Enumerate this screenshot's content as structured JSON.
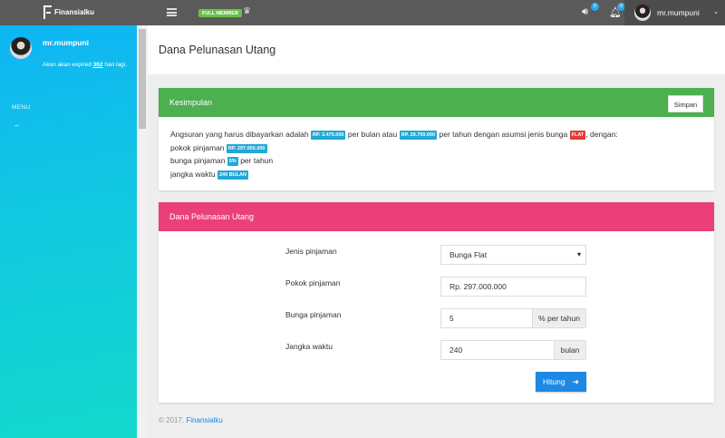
{
  "topbar": {
    "brand": "Finansialku",
    "member_badge": "FULL MEMBER",
    "sound_count": "0",
    "bell_count": "0",
    "username": "mr.mumpuni"
  },
  "sidebar": {
    "username": "mr.mumpuni",
    "expire_prefix": "Akun akan expired",
    "expire_days": "362",
    "expire_suffix": "hari lagi.",
    "menu_label": "MENU",
    "menu_dash": "–"
  },
  "page": {
    "title": "Dana Pelunasan Utang"
  },
  "summary_card": {
    "title": "Kesimpulan",
    "save_label": "Simpan",
    "text1": "Angsuran yang harus dibayarkan adalah",
    "monthly": "RP. 3.475.000",
    "text2": "per bulan atau",
    "yearly": "RP. 29.700.000",
    "text3": "per tahun dengan asumsi jenis bunga",
    "interest_type": "FLAT",
    "text4": ", dengan:",
    "principal_label": "pokok pinjaman",
    "principal": "RP. 297.000.000",
    "rate_label": "bunga pinjaman",
    "rate": "5%",
    "rate_suffix": "per tahun",
    "term_label": "jangka waktu",
    "term": "240 BULAN"
  },
  "form_card": {
    "title": "Dana Pelunasan Utang",
    "loan_type_label": "Jenis pinjaman",
    "loan_type_value": "Bunga Flat",
    "principal_label": "Pokok pinjaman",
    "principal_value": "Rp. 297.000.000",
    "rate_label": "Bunga pinjaman",
    "rate_value": "5",
    "rate_addon": "% per tahun",
    "term_label": "Jangka waktu",
    "term_value": "240",
    "term_addon": "bulan",
    "submit_label": "Hitung"
  },
  "footer": {
    "copyright": "© 2017.",
    "brand_link": "Finansialku"
  }
}
